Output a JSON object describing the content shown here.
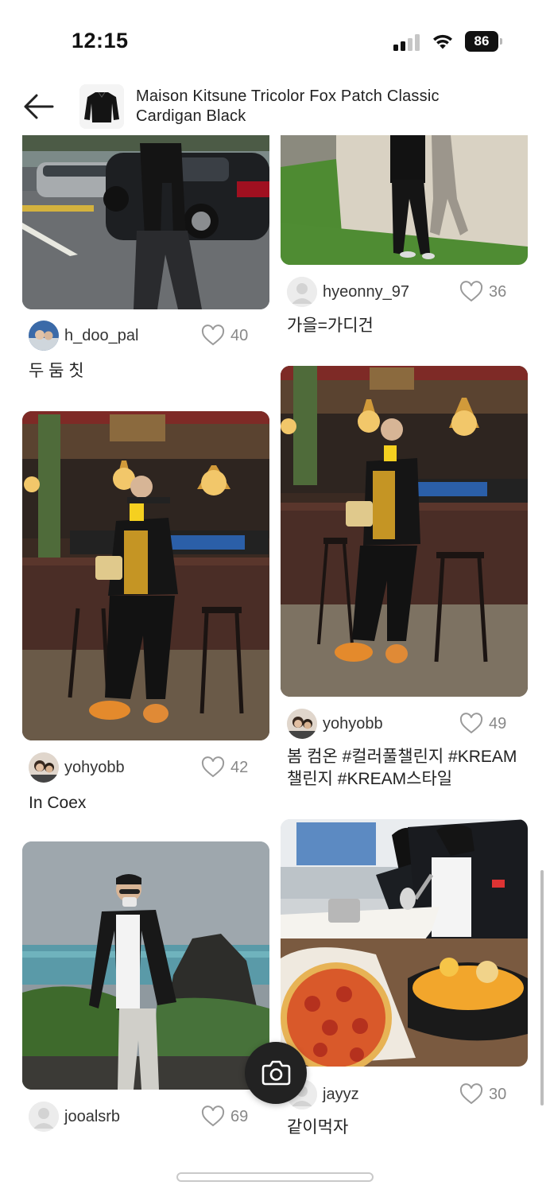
{
  "status_bar": {
    "time": "12:15",
    "battery": "86"
  },
  "header": {
    "title": "Maison Kitsune Tricolor Fox Patch Classic Cardigan Black",
    "back_icon": "arrow-left-icon"
  },
  "posts": [
    {
      "id": "post-h_doo_pal",
      "username": "h_doo_pal",
      "likes": "40",
      "caption": "두 둠 칫"
    },
    {
      "id": "post-hyeonny_97",
      "username": "hyeonny_97",
      "likes": "36",
      "caption": "가을=가디건"
    },
    {
      "id": "post-yohyobb-1",
      "username": "yohyobb",
      "likes": "42",
      "caption": "In Coex"
    },
    {
      "id": "post-yohyobb-2",
      "username": "yohyobb",
      "likes": "49",
      "caption": "봄 컴온 #컬러풀챌린지 #KREAM챌린지 #KREAM스타일"
    },
    {
      "id": "post-jooalsrb",
      "username": "jooalsrb",
      "likes": "69",
      "caption": ""
    },
    {
      "id": "post-jayyz",
      "username": "jayyz",
      "likes": "30",
      "caption": "같이먹자"
    }
  ],
  "fab": {
    "icon": "camera-icon"
  },
  "colors": {
    "text": "#222222",
    "muted": "#888888",
    "background": "#ffffff",
    "fab": "#222222"
  }
}
